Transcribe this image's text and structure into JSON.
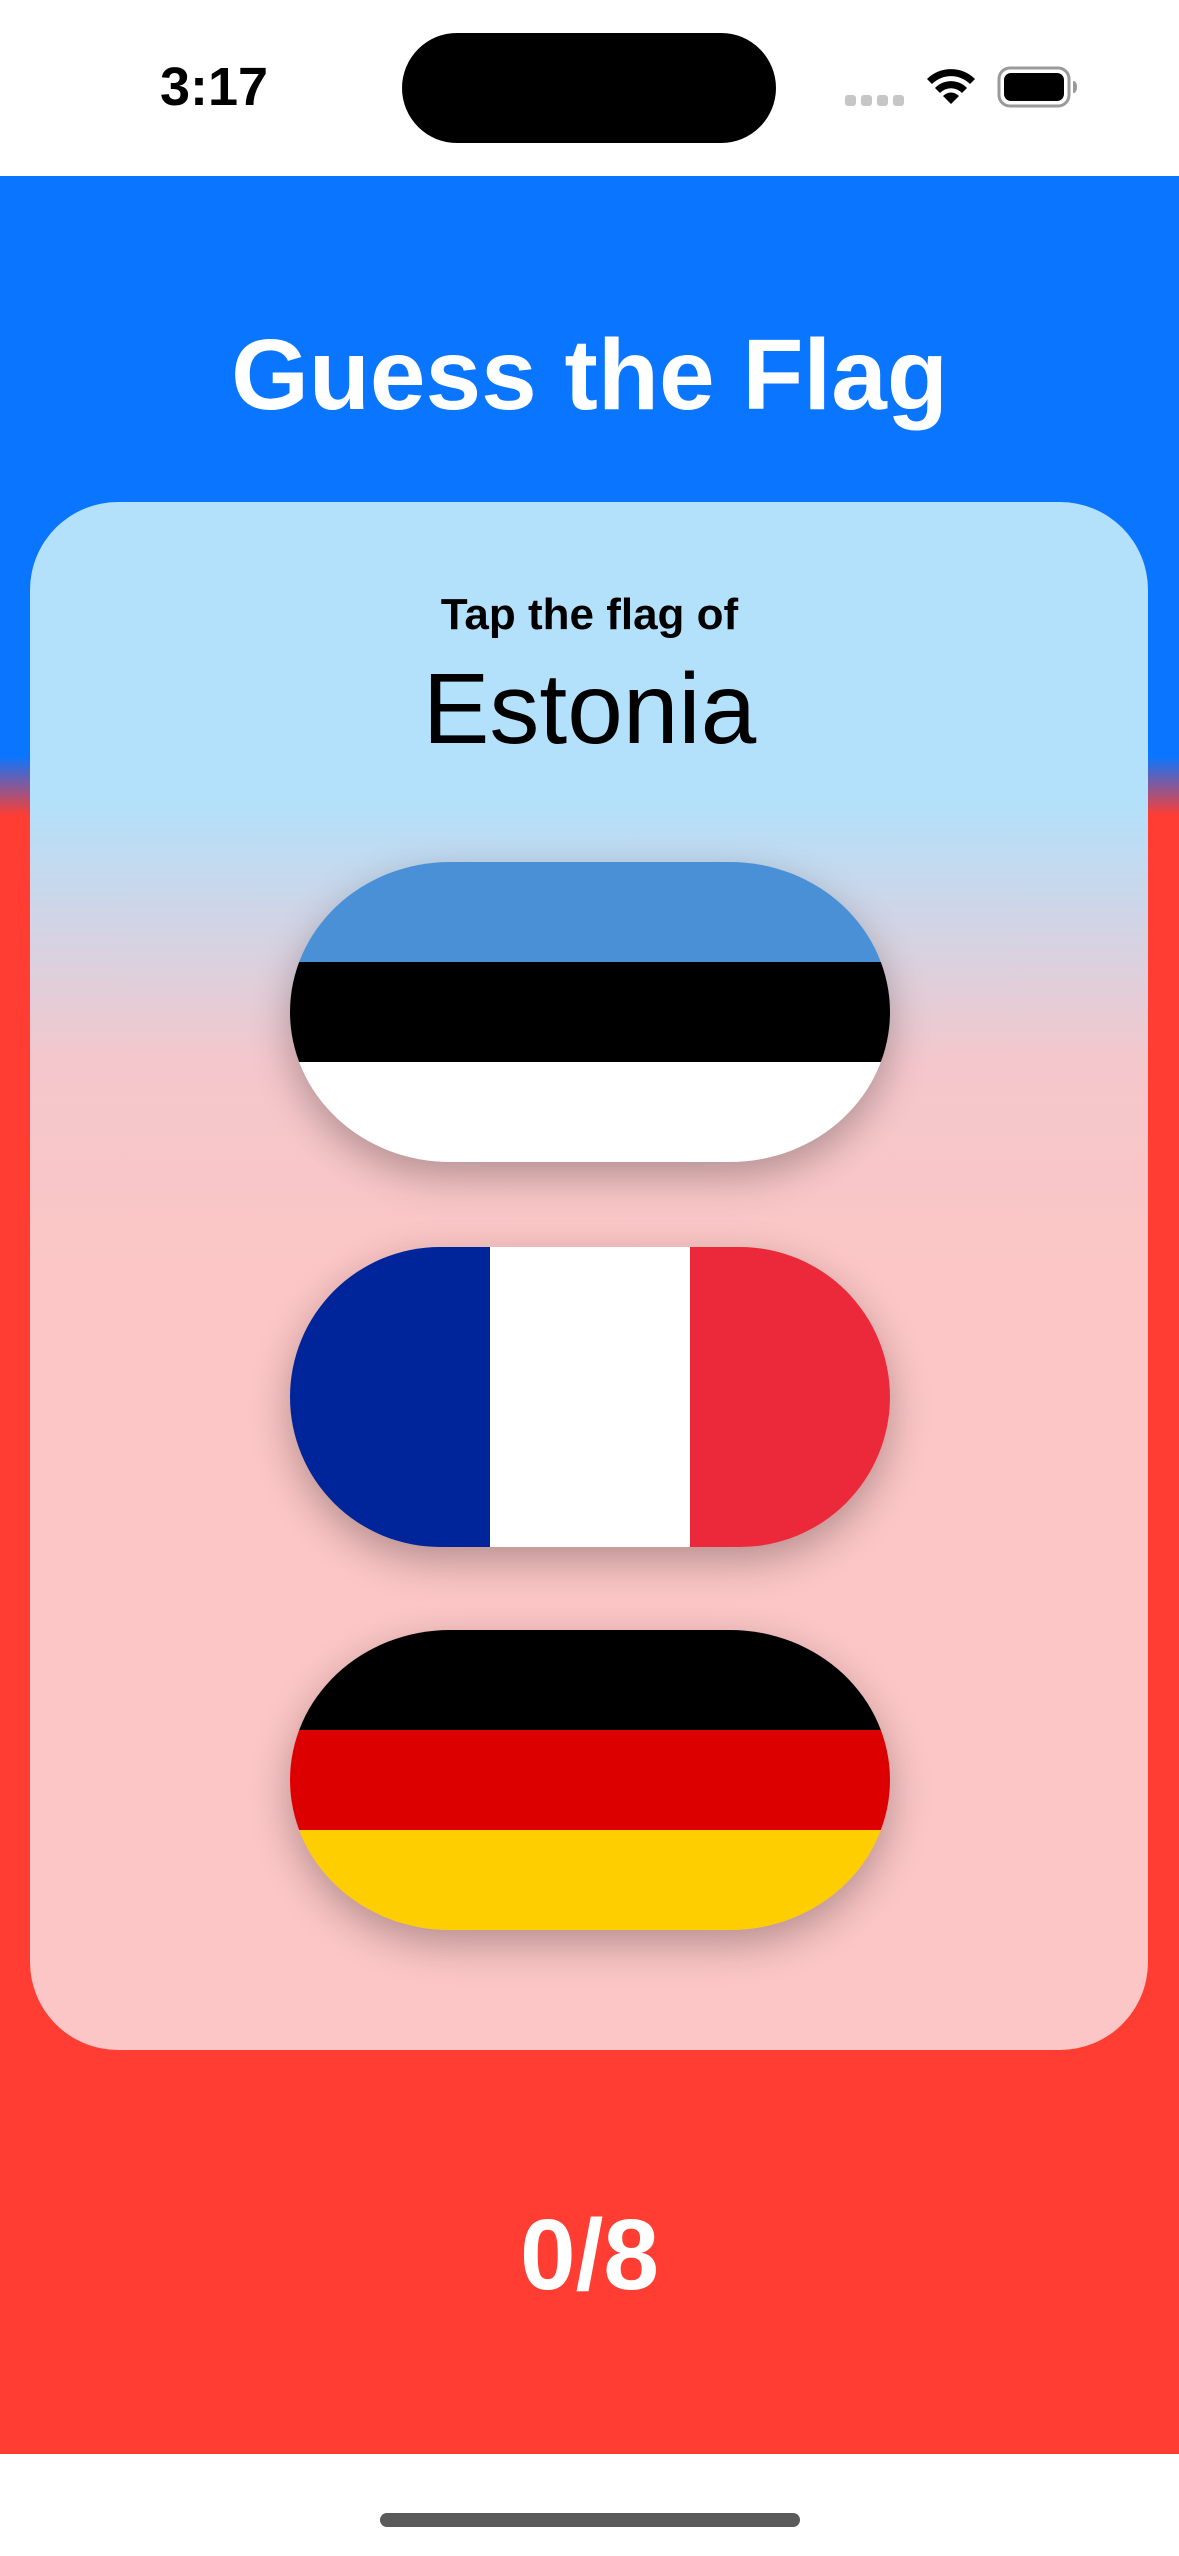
{
  "status_bar": {
    "time": "3:17",
    "icons": [
      "cellular-signal-icon",
      "wifi-icon",
      "battery-icon"
    ]
  },
  "app": {
    "title": "Guess the Flag",
    "prompt_label": "Tap the flag of",
    "country": "Estonia",
    "score": "0/8",
    "colors": {
      "top_background": "#0a76ff",
      "bottom_background": "#ff3d32",
      "card_top": "#b3e0fb",
      "card_bottom": "#fbc6c5",
      "text_light": "#ffffff",
      "text_dark": "#000000"
    }
  },
  "flags": [
    {
      "name": "flag-estonia",
      "orientation": "horizontal",
      "stripes": [
        "#4a90d6",
        "#000000",
        "#ffffff"
      ]
    },
    {
      "name": "flag-france",
      "orientation": "vertical",
      "stripes": [
        "#00249a",
        "#ffffff",
        "#ec293a"
      ]
    },
    {
      "name": "flag-germany",
      "orientation": "horizontal",
      "stripes": [
        "#000000",
        "#dd0000",
        "#ffce00"
      ]
    }
  ]
}
